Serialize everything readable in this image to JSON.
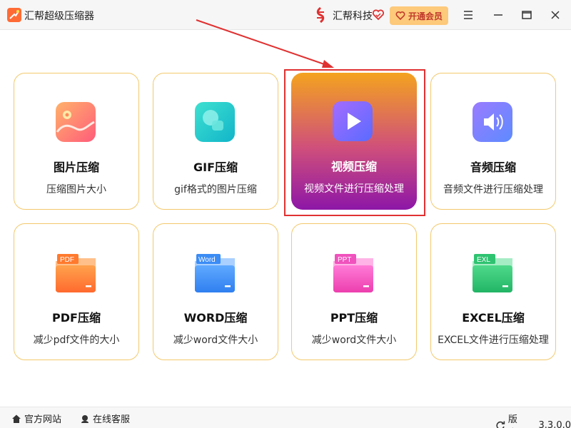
{
  "app": {
    "title": "汇帮超级压缩器"
  },
  "header": {
    "brand": "汇帮科技",
    "vip_label": "开通会员"
  },
  "cards": [
    {
      "title": "图片压缩",
      "desc": "压缩图片大小",
      "icon": "image-icon"
    },
    {
      "title": "GIF压缩",
      "desc": "gif格式的图片压缩",
      "icon": "gif-icon"
    },
    {
      "title": "视频压缩",
      "desc": "视频文件进行压缩处理",
      "icon": "video-play-icon",
      "active": true
    },
    {
      "title": "音频压缩",
      "desc": "音频文件进行压缩处理",
      "icon": "speaker-icon"
    },
    {
      "title": "PDF压缩",
      "desc": "减少pdf文件的大小",
      "icon": "pdf-folder-icon",
      "badge": "PDF"
    },
    {
      "title": "WORD压缩",
      "desc": "减少word文件大小",
      "icon": "word-folder-icon",
      "badge": "Word"
    },
    {
      "title": "PPT压缩",
      "desc": "减少word文件大小",
      "icon": "ppt-folder-icon",
      "badge": "PPT"
    },
    {
      "title": "EXCEL压缩",
      "desc": "EXCEL文件进行压缩处理",
      "icon": "excel-folder-icon",
      "badge": "EXL"
    }
  ],
  "footer": {
    "website": "官方网站",
    "support": "在线客服",
    "version_label": "版本：",
    "version": "3.3.0.0"
  },
  "colors": {
    "accent": "#f3c96d",
    "vip_bg": "#fdc97a",
    "annotation": "#e03131",
    "active_gradient_top": "#f4a31f",
    "active_gradient_bottom": "#8d16a7"
  }
}
